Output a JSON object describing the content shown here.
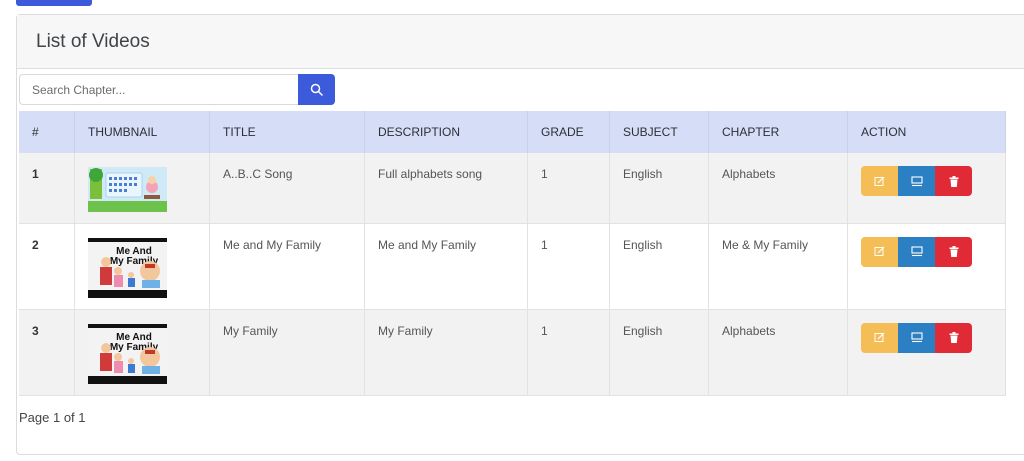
{
  "header": {
    "title": "List of Videos"
  },
  "search": {
    "placeholder": "Search Chapter..."
  },
  "table": {
    "columns": [
      "#",
      "THUMBNAIL",
      "TITLE",
      "DESCRIPTION",
      "GRADE",
      "SUBJECT",
      "CHAPTER",
      "ACTION"
    ],
    "rows": [
      {
        "num": "1",
        "thumbnail": "abc-song-thumbnail",
        "title": "A..B..C Song",
        "description": "Full alphabets song",
        "grade": "1",
        "subject": "English",
        "chapter": "Alphabets"
      },
      {
        "num": "2",
        "thumbnail": "me-and-my-family-thumbnail",
        "title": "Me and My Family",
        "description": "Me and My Family",
        "grade": "1",
        "subject": "English",
        "chapter": "Me & My Family"
      },
      {
        "num": "3",
        "thumbnail": "me-and-my-family-thumbnail",
        "title": "My Family",
        "description": "My Family",
        "grade": "1",
        "subject": "English",
        "chapter": "Alphabets"
      }
    ]
  },
  "thumb_text": {
    "line1": "Me And",
    "line2": "My Family"
  },
  "icons": {
    "search": "search-icon",
    "edit": "edit-icon",
    "view": "monitor-icon",
    "delete": "trash-icon"
  },
  "colors": {
    "primary": "#3b5bdb",
    "edit": "#f5bd55",
    "view": "#2b7fc3",
    "delete": "#e02a36",
    "header_row": "#d6def7"
  },
  "footer": {
    "pagination": "Page 1 of 1"
  }
}
